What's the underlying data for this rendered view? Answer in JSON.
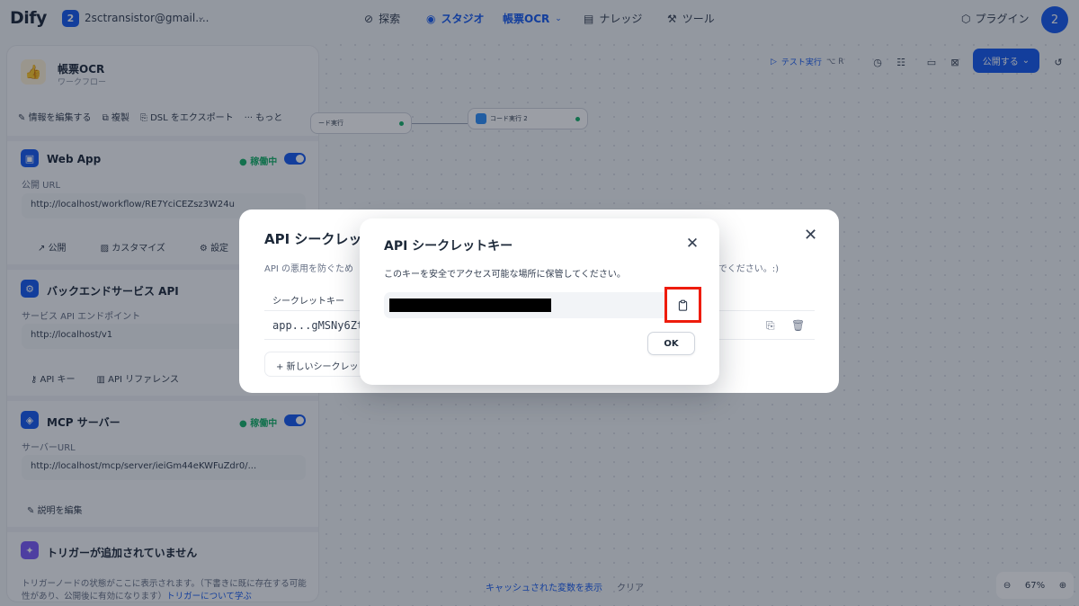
{
  "topbar": {
    "logo": "Dify",
    "workspace_badge": "2",
    "workspace_name": "2sctransistor@gmail....",
    "nav": {
      "explore": "探索",
      "studio": "スタジオ",
      "app_name": "帳票OCR",
      "knowledge": "ナレッジ",
      "tools": "ツール"
    },
    "plugins": "プラグイン",
    "avatar": "2"
  },
  "panel": {
    "app_name": "帳票OCR",
    "app_type": "ワークフロー",
    "actions": [
      "情報を編集する",
      "複製",
      "DSL をエクスポート",
      "もっと"
    ],
    "webapp": {
      "title": "Web App",
      "status": "稼働中",
      "url_label": "公開 URL",
      "url": "http://localhost/workflow/RE7YciCEZsz3W24u",
      "actions": [
        "公開",
        "カスタマイズ",
        "設定"
      ]
    },
    "backend": {
      "title": "バックエンドサービス API",
      "endpoint_label": "サービス API エンドポイント",
      "endpoint": "http://localhost/v1",
      "actions": [
        "API キー",
        "API リファレンス"
      ]
    },
    "mcp": {
      "title": "MCP サーバー",
      "status": "稼働中",
      "url_label": "サーバーURL",
      "url": "http://localhost/mcp/server/ieiGm44eKWFuZdr0/...",
      "edit_desc": "説明を編集"
    },
    "trigger": {
      "title": "トリガーが追加されていません",
      "text": "トリガーノードの状態がここに表示されます。（下書きに既に存在する可能性があり、公開後に有効になります）",
      "link": "トリガーについて学ぶ"
    }
  },
  "canvas": {
    "node1": "ード実行",
    "node2": "コード実行 2",
    "test_run": "テスト実行",
    "test_shortcut": "⌥ R",
    "publish": "公開する",
    "cache_link": "キャッシュされた変数を表示",
    "clear": "クリア",
    "zoom": "67%"
  },
  "back_dialog": {
    "title": "API シークレッ",
    "desc_left": "API の悪用を防ぐため",
    "desc_right": "いでください。:)",
    "col_header": "シークレットキー",
    "key": "app...gMSNy6Zt",
    "new_button": "+ 新しいシークレッ"
  },
  "dialog": {
    "title": "API シークレットキー",
    "desc": "このキーを安全でアクセス可能な場所に保管してください。",
    "ok": "OK"
  },
  "colors": {
    "accent": "#155aef",
    "highlight": "#ee1c0c",
    "success": "#17b26a"
  }
}
